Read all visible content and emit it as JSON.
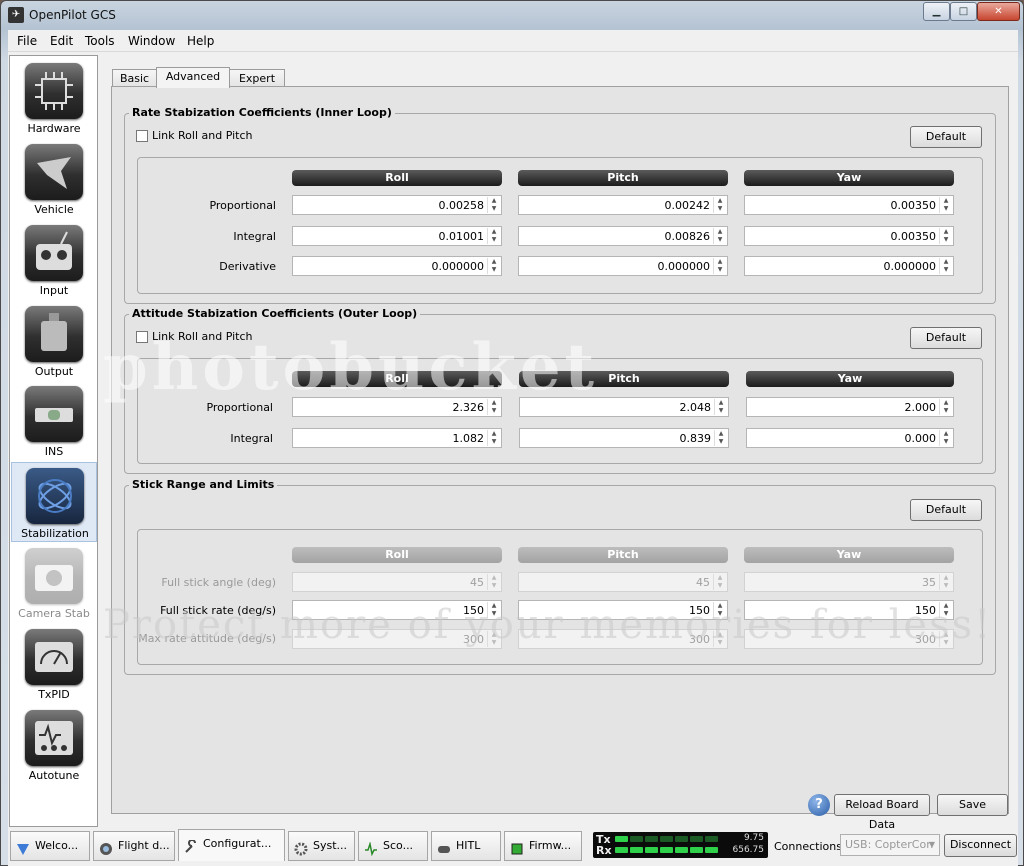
{
  "window": {
    "title": "OpenPilot GCS",
    "min_label": "▁",
    "max_label": "□",
    "close_label": "✕"
  },
  "menu": [
    "File",
    "Edit",
    "Tools",
    "Window",
    "Help"
  ],
  "sidebar": [
    {
      "label": "Hardware",
      "icon": "chip-icon"
    },
    {
      "label": "Vehicle",
      "icon": "vehicle-icon"
    },
    {
      "label": "Input",
      "icon": "transmitter-icon"
    },
    {
      "label": "Output",
      "icon": "motor-icon"
    },
    {
      "label": "INS",
      "icon": "level-icon"
    },
    {
      "label": "Stabilization",
      "icon": "gyro-icon",
      "active": true
    },
    {
      "label": "Camera Stab",
      "icon": "camera-icon"
    },
    {
      "label": "TxPID",
      "icon": "meter-icon"
    },
    {
      "label": "Autotune",
      "icon": "autotune-icon"
    }
  ],
  "tabs": [
    "Basic",
    "Advanced",
    "Expert"
  ],
  "active_tab": "Advanced",
  "rate": {
    "title": "Rate Stabization Coefficients (Inner Loop)",
    "link": "Link Roll and Pitch",
    "default": "Default",
    "columns": [
      "Roll",
      "Pitch",
      "Yaw"
    ],
    "rows": [
      {
        "label": "Proportional",
        "values": [
          "0.00258",
          "0.00242",
          "0.00350"
        ]
      },
      {
        "label": "Integral",
        "values": [
          "0.01001",
          "0.00826",
          "0.00350"
        ]
      },
      {
        "label": "Derivative",
        "values": [
          "0.000000",
          "0.000000",
          "0.000000"
        ]
      }
    ]
  },
  "attitude": {
    "title": "Attitude Stabization Coefficients (Outer Loop)",
    "link": "Link Roll and Pitch",
    "default": "Default",
    "columns": [
      "Roll",
      "Pitch",
      "Yaw"
    ],
    "rows": [
      {
        "label": "Proportional",
        "values": [
          "2.326",
          "2.048",
          "2.000"
        ]
      },
      {
        "label": "Integral",
        "values": [
          "1.082",
          "0.839",
          "0.000"
        ]
      }
    ]
  },
  "stick": {
    "title": "Stick Range and Limits",
    "default": "Default",
    "columns": [
      "Roll",
      "Pitch",
      "Yaw"
    ],
    "rows": [
      {
        "label": "Full stick angle (deg)",
        "values": [
          "45",
          "45",
          "35"
        ],
        "enabled": false
      },
      {
        "label": "Full stick rate (deg/s)",
        "values": [
          "150",
          "150",
          "150"
        ],
        "enabled": true
      },
      {
        "label": "Max rate attitude (deg/s)",
        "values": [
          "300",
          "300",
          "300"
        ],
        "enabled": false
      }
    ]
  },
  "footer": {
    "reload": "Reload Board Data",
    "save": "Save"
  },
  "bottom_tabs": [
    "Welco...",
    "Flight d...",
    "Configurat...",
    "Syst...",
    "Sco...",
    "HITL",
    "Firmw..."
  ],
  "active_bottom_tab": "Configurat...",
  "telemetry": {
    "tx": "Tx",
    "rx": "Rx",
    "tx_rate": "9.75",
    "rx_rate": "656.75"
  },
  "connections": {
    "label": "Connections:",
    "device": "USB: CopterCon",
    "disconnect": "Disconnect"
  },
  "watermark": {
    "line1": "photobucket",
    "line2": "Protect more of your memories for less!"
  }
}
